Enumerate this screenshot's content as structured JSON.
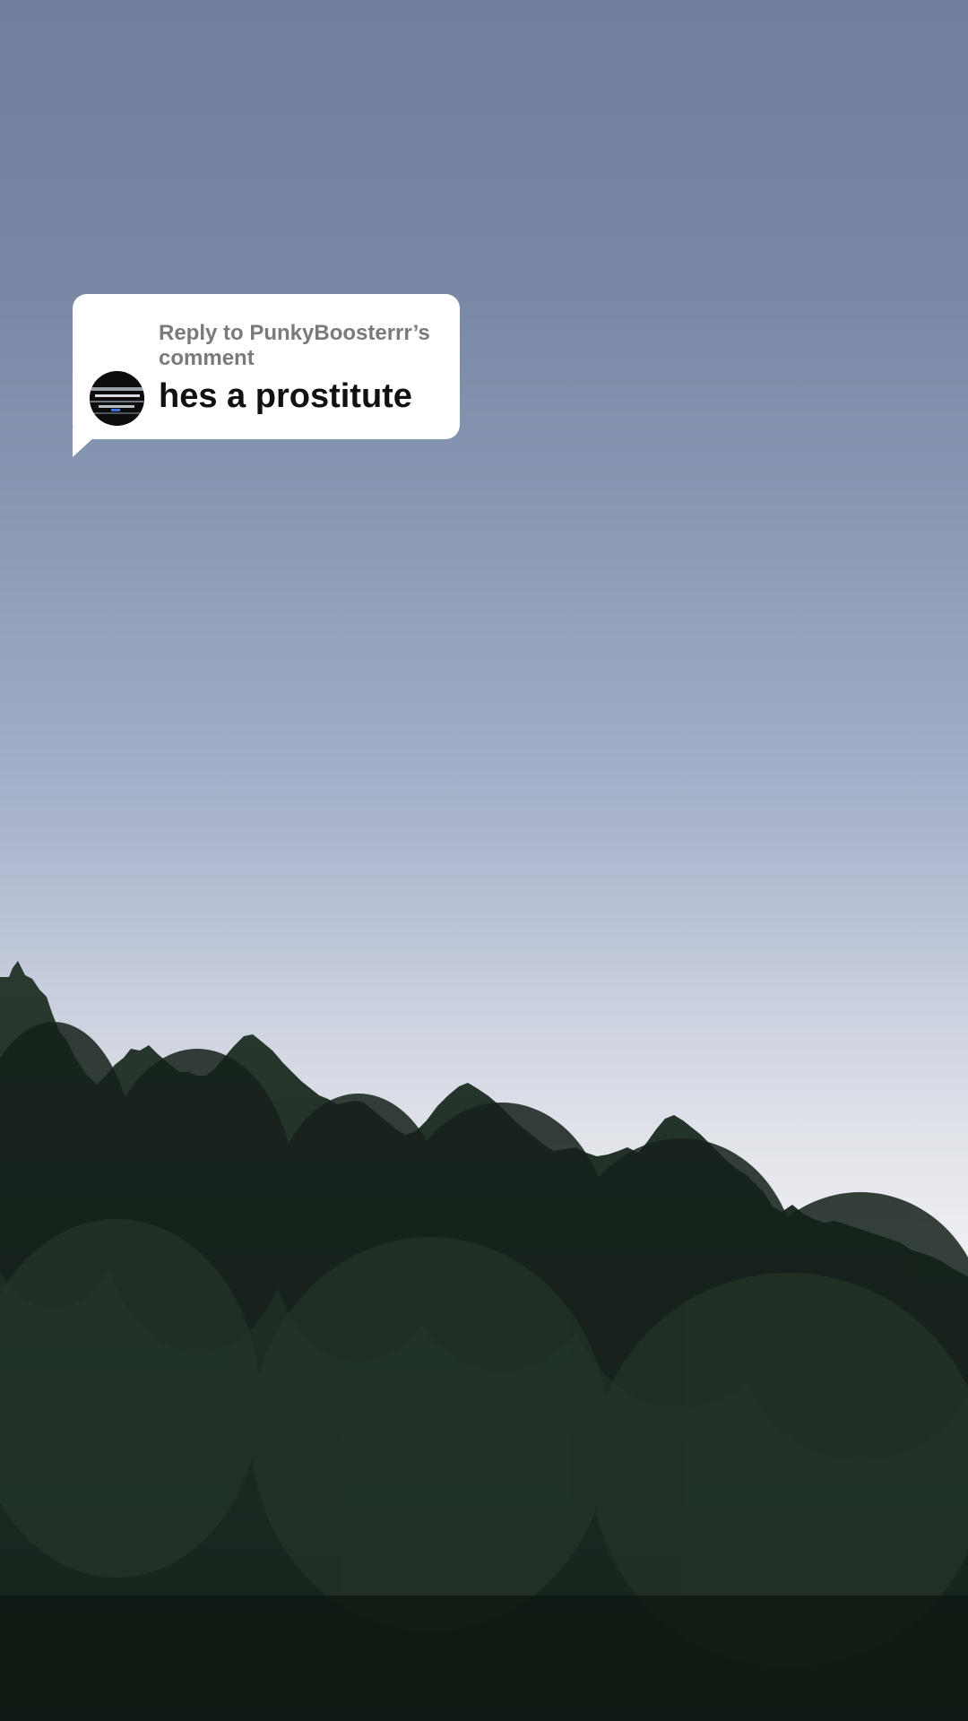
{
  "reply_card": {
    "header": "Reply to PunkyBoosterrr’s comment",
    "comment": "hes a prostitute",
    "avatar_icon": "user-avatar"
  },
  "background": {
    "sky_top_color": "#6f7f9c",
    "sky_bottom_color": "#eceef2",
    "tree_color": "#1c2a22"
  }
}
